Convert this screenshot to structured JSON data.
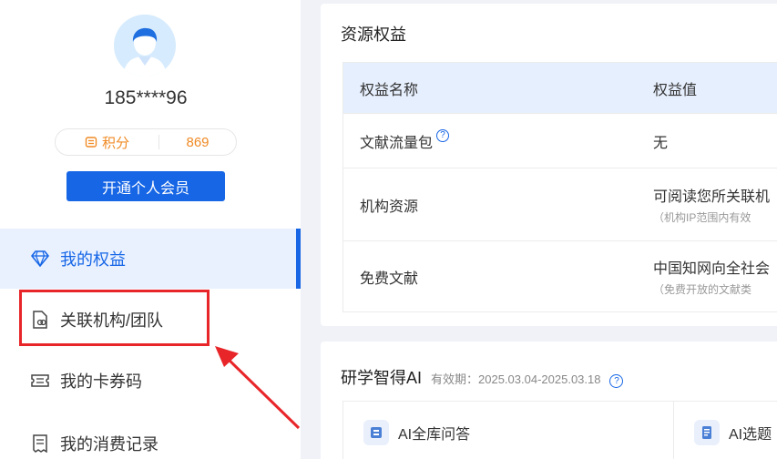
{
  "profile": {
    "username": "185****96",
    "points_label": "积分",
    "points_value": "869",
    "vip_button": "开通个人会员"
  },
  "sidebar": {
    "items": [
      {
        "label": "我的权益",
        "icon": "diamond-icon",
        "active": true
      },
      {
        "label": "关联机构/团队",
        "icon": "link-document-icon",
        "active": false
      },
      {
        "label": "我的卡券码",
        "icon": "ticket-icon",
        "active": false
      },
      {
        "label": "我的消费记录",
        "icon": "receipt-icon",
        "active": false
      }
    ]
  },
  "resources": {
    "title": "资源权益",
    "columns": [
      "权益名称",
      "权益值"
    ],
    "rows": [
      {
        "name": "文献流量包",
        "value": "无",
        "sub": ""
      },
      {
        "name": "机构资源",
        "value": "可阅读您所关联机",
        "sub": "（机构IP范围内有效"
      },
      {
        "name": "免费文献",
        "value": "中国知网向全社会",
        "sub": "（免费开放的文献类"
      }
    ]
  },
  "ai": {
    "title": "研学智得AI",
    "validity": "有效期：2025.03.04-2025.03.18",
    "boxes": [
      {
        "label": "AI全库问答",
        "icon": "database-icon"
      },
      {
        "label": "AI选题",
        "icon": "document-list-icon"
      }
    ]
  },
  "colors": {
    "accent": "#1666e6",
    "points": "#f08a24",
    "highlight": "#e8262a"
  }
}
